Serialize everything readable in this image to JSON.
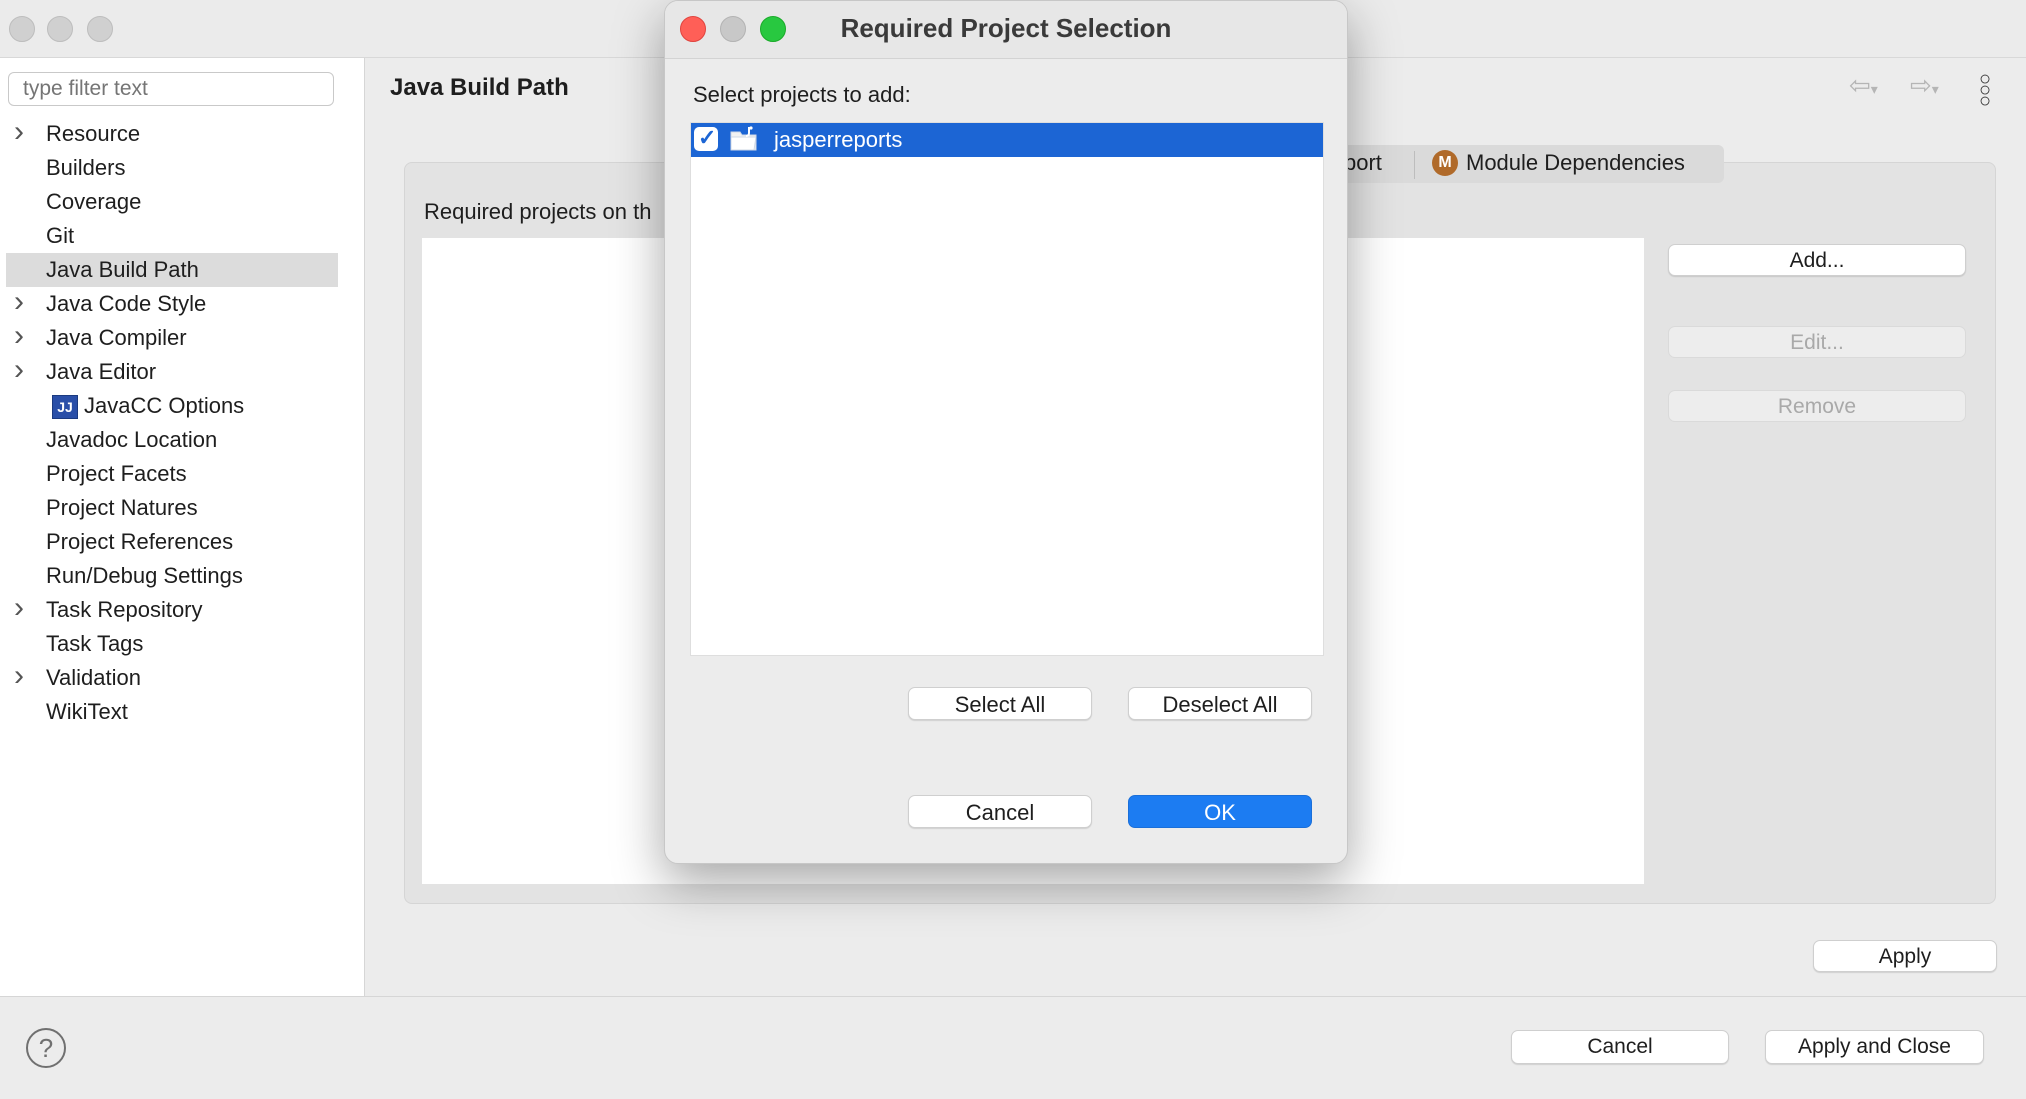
{
  "window": {
    "traffic_lights": [
      "close",
      "minimize",
      "zoom"
    ]
  },
  "sidebar": {
    "filter_placeholder": "type filter text",
    "items": [
      {
        "label": "Resource",
        "expandable": true
      },
      {
        "label": "Builders",
        "expandable": false
      },
      {
        "label": "Coverage",
        "expandable": false
      },
      {
        "label": "Git",
        "expandable": false
      },
      {
        "label": "Java Build Path",
        "expandable": false,
        "selected": true
      },
      {
        "label": "Java Code Style",
        "expandable": true
      },
      {
        "label": "Java Compiler",
        "expandable": true
      },
      {
        "label": "Java Editor",
        "expandable": true
      },
      {
        "label": "JavaCC Options",
        "expandable": false,
        "icon": "javacc-icon"
      },
      {
        "label": "Javadoc Location",
        "expandable": false
      },
      {
        "label": "Project Facets",
        "expandable": false
      },
      {
        "label": "Project Natures",
        "expandable": false
      },
      {
        "label": "Project References",
        "expandable": false
      },
      {
        "label": "Run/Debug Settings",
        "expandable": false
      },
      {
        "label": "Task Repository",
        "expandable": true
      },
      {
        "label": "Task Tags",
        "expandable": false
      },
      {
        "label": "Validation",
        "expandable": true
      },
      {
        "label": "WikiText",
        "expandable": false
      }
    ]
  },
  "content": {
    "page_title": "Java Build Path",
    "tab_partial": "port",
    "tab_module": "Module Dependencies",
    "tab_module_icon_letter": "M",
    "required_label": "Required projects on th",
    "buttons": {
      "add": "Add...",
      "edit": "Edit...",
      "remove": "Remove",
      "apply": "Apply"
    }
  },
  "footer": {
    "cancel": "Cancel",
    "apply_close": "Apply and Close",
    "help_icon": "?"
  },
  "dialog": {
    "title": "Required Project Selection",
    "prompt": "Select projects to add:",
    "projects": [
      {
        "name": "jasperreports",
        "checked": true
      }
    ],
    "check_glyph": "✓",
    "select_all": "Select All",
    "deselect_all": "Deselect All",
    "cancel": "Cancel",
    "ok": "OK"
  },
  "colors": {
    "accent": "#1c7cf2",
    "selection": "#1c65d4",
    "close": "#ff5f57",
    "minimize": "#c8c8c8",
    "zoom": "#28c840"
  }
}
